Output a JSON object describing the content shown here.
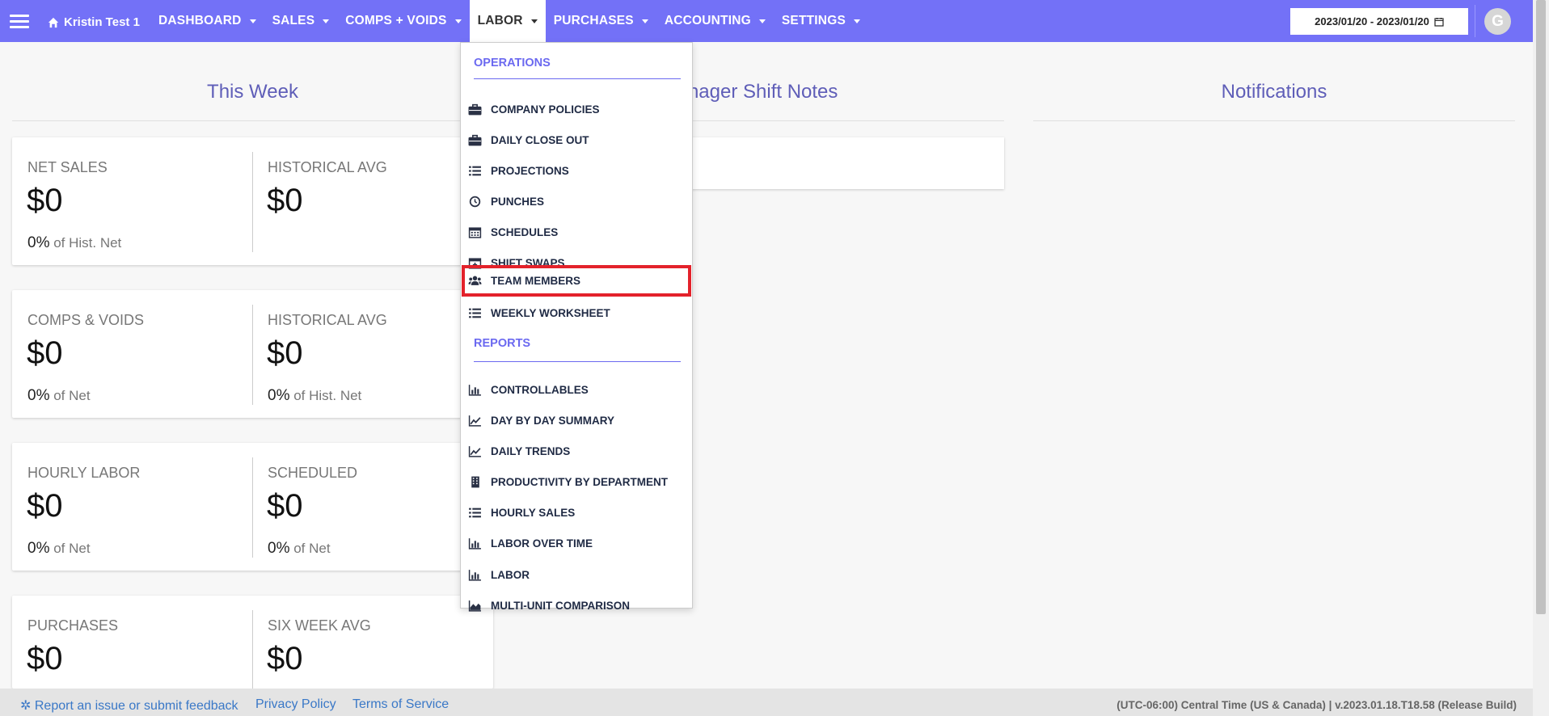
{
  "header": {
    "brand": "Kristin Test 1",
    "nav": [
      "DASHBOARD",
      "SALES",
      "COMPS + VOIDS",
      "LABOR",
      "PURCHASES",
      "ACCOUNTING",
      "SETTINGS"
    ],
    "active_nav": "LABOR",
    "date_range": "2023/01/20 - 2023/01/20",
    "avatar_letter": "G",
    "accent_color": "#7371f7"
  },
  "columns": {
    "this_week": "This Week",
    "manager_notes": "Manager Shift Notes",
    "notifications": "Notifications"
  },
  "cards": [
    {
      "left": {
        "label": "NET SALES",
        "value": "$0",
        "pct": "0%",
        "sub": "of Hist. Net"
      },
      "right": {
        "label": "HISTORICAL AVG",
        "value": "$0",
        "pct": "",
        "sub": ""
      }
    },
    {
      "left": {
        "label": "COMPS & VOIDS",
        "value": "$0",
        "pct": "0%",
        "sub": "of Net"
      },
      "right": {
        "label": "HISTORICAL AVG",
        "value": "$0",
        "pct": "0%",
        "sub": "of Hist. Net"
      }
    },
    {
      "left": {
        "label": "HOURLY LABOR",
        "value": "$0",
        "pct": "0%",
        "sub": "of Net"
      },
      "right": {
        "label": "SCHEDULED",
        "value": "$0",
        "pct": "0%",
        "sub": "of Net"
      }
    },
    {
      "left": {
        "label": "PURCHASES",
        "value": "$0",
        "pct": "",
        "sub": ""
      },
      "right": {
        "label": "SIX WEEK AVG",
        "value": "$0",
        "pct": "",
        "sub": ""
      }
    }
  ],
  "labor_menu": {
    "operations_heading": "OPERATIONS",
    "operations": [
      {
        "label": "COMPANY POLICIES",
        "icon": "briefcase-icon"
      },
      {
        "label": "DAILY CLOSE OUT",
        "icon": "briefcase-icon"
      },
      {
        "label": "PROJECTIONS",
        "icon": "list-icon"
      },
      {
        "label": "PUNCHES",
        "icon": "clock-icon"
      },
      {
        "label": "SCHEDULES",
        "icon": "calendar-icon"
      },
      {
        "label": "SHIFT SWAPS",
        "icon": "calendar-plus-icon"
      },
      {
        "label": "TEAM MEMBERS",
        "icon": "users-icon"
      },
      {
        "label": "WEEKLY WORKSHEET",
        "icon": "list-icon"
      }
    ],
    "reports_heading": "REPORTS",
    "reports": [
      {
        "label": "CONTROLLABLES",
        "icon": "bar-chart-icon"
      },
      {
        "label": "DAY BY DAY SUMMARY",
        "icon": "line-chart-icon"
      },
      {
        "label": "DAILY TRENDS",
        "icon": "line-chart-icon"
      },
      {
        "label": "PRODUCTIVITY BY DEPARTMENT",
        "icon": "building-icon"
      },
      {
        "label": "HOURLY SALES",
        "icon": "list-icon"
      },
      {
        "label": "LABOR OVER TIME",
        "icon": "bar-chart-icon"
      },
      {
        "label": "LABOR",
        "icon": "bar-chart-icon"
      },
      {
        "label": "MULTI-UNIT COMPARISON",
        "icon": "area-chart-icon"
      }
    ],
    "highlighted_item": "TEAM MEMBERS"
  },
  "footer": {
    "report_issue": "Report an issue or submit feedback",
    "privacy": "Privacy Policy",
    "terms": "Terms of Service",
    "build": "(UTC-06:00) Central Time (US & Canada) | v.2023.01.18.T18.58 (Release Build)"
  }
}
